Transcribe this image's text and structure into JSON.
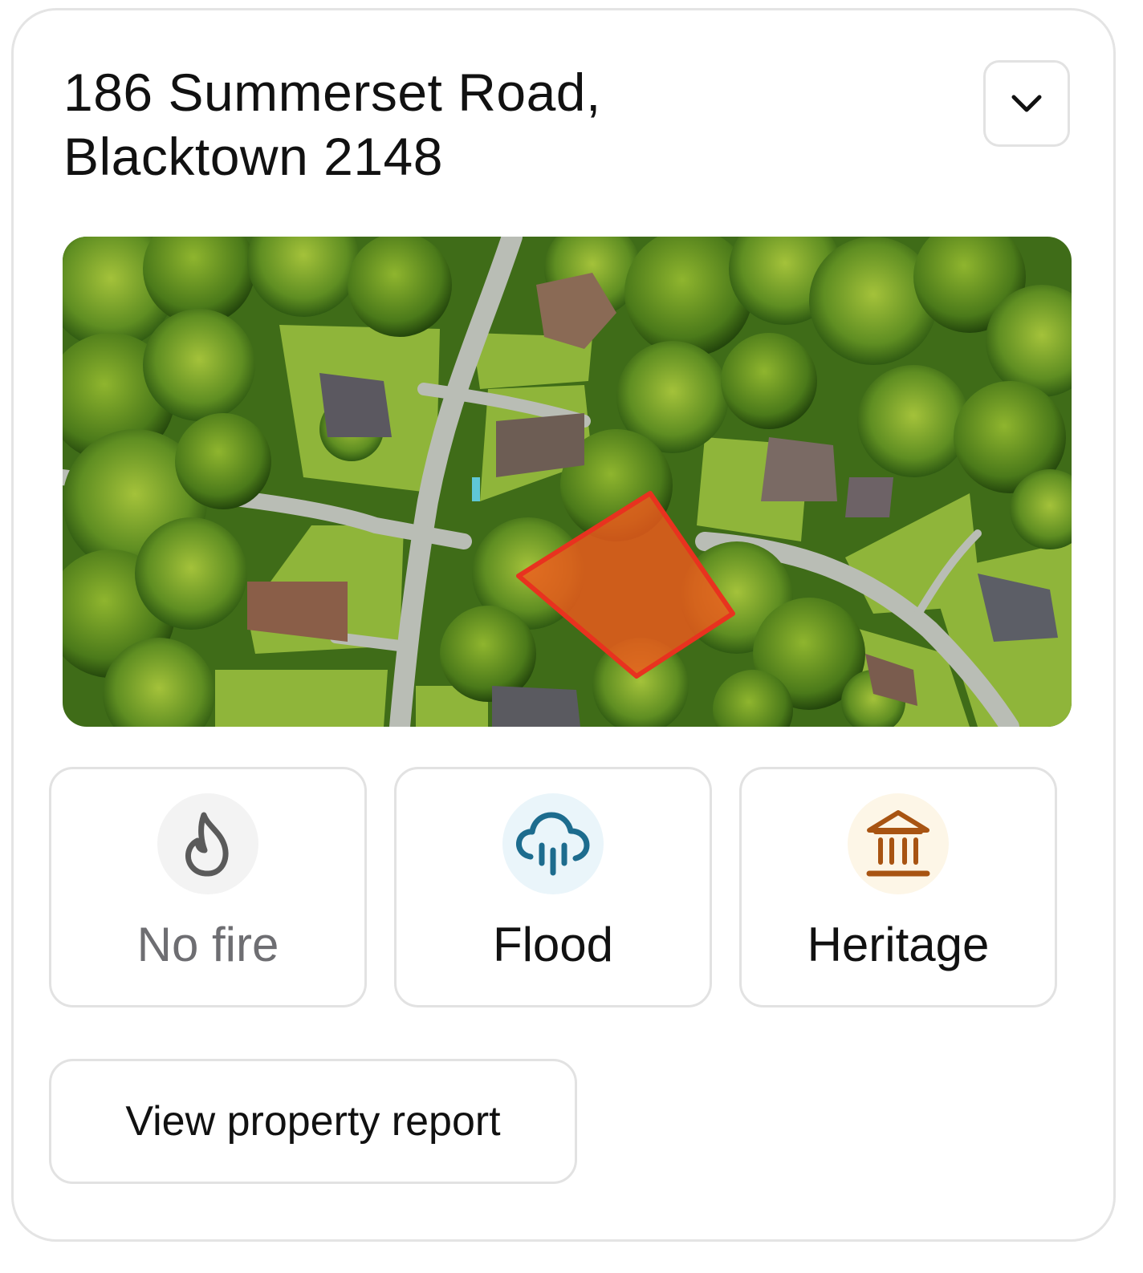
{
  "property": {
    "address_line1": "186 Summerset Road,",
    "address_line2": "Blacktown 2148"
  },
  "toggle": {
    "icon": "chevron-down-icon"
  },
  "map": {
    "highlight_color": "#e8321f"
  },
  "risk_tiles": [
    {
      "label": "No fire",
      "icon": "flame-icon",
      "color": "#5a5a5a",
      "bg": "#f3f3f3",
      "text_color": "#6e6e72",
      "active": false
    },
    {
      "label": "Flood",
      "icon": "rain-cloud-icon",
      "color": "#1d6c8e",
      "bg": "#eaf5fa",
      "text_color": "#111111",
      "active": true
    },
    {
      "label": "Heritage",
      "icon": "heritage-building-icon",
      "color": "#a85412",
      "bg": "#fdf6e7",
      "text_color": "#111111",
      "active": true
    }
  ],
  "actions": {
    "view_report_label": "View property report"
  }
}
